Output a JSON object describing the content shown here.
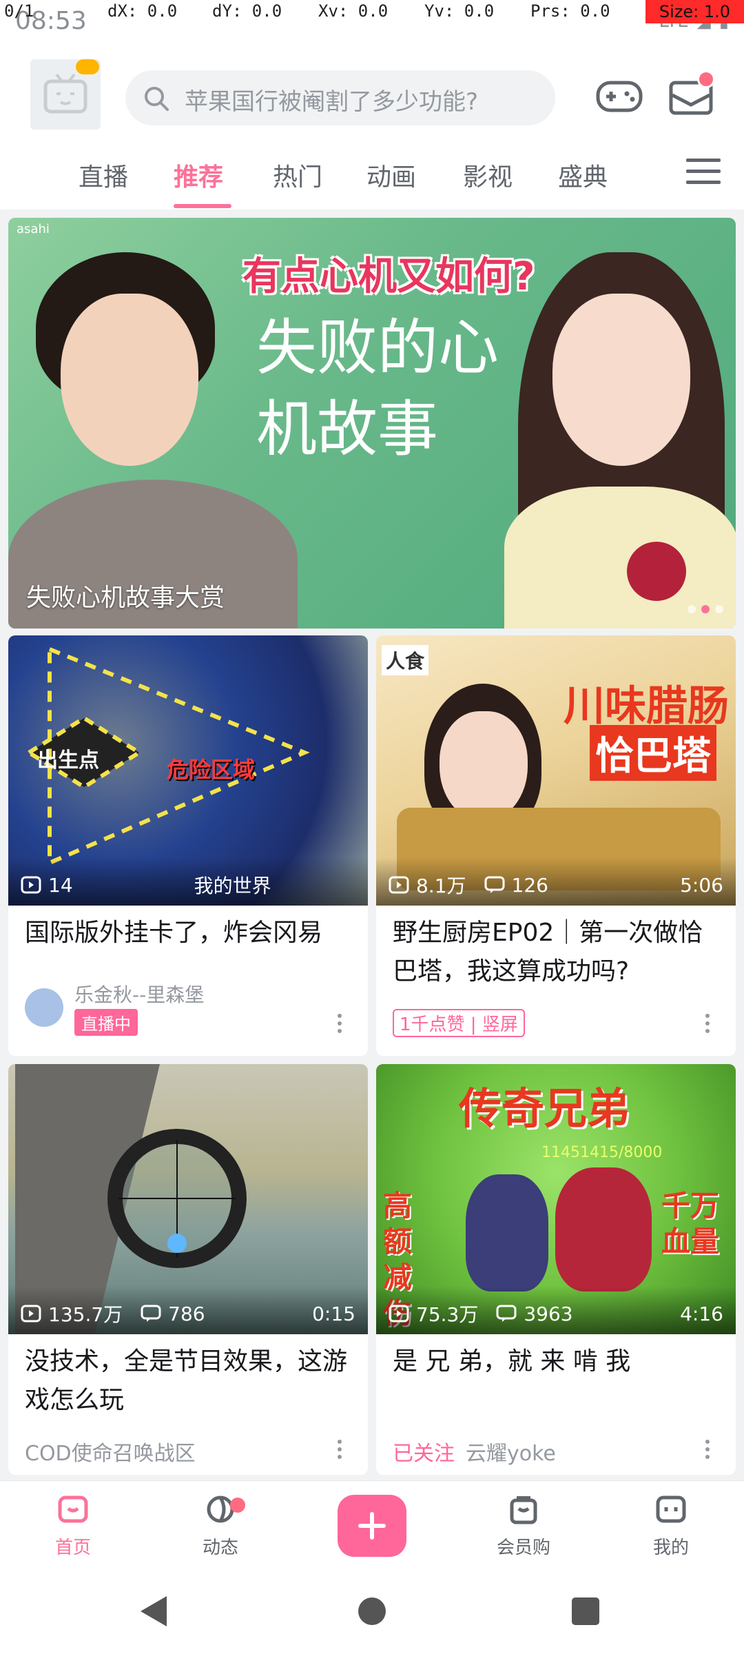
{
  "status_bar": {
    "time": "08:53",
    "network": "LTE",
    "overlay": {
      "pointer": "0/1",
      "dx": "dX: 0.0",
      "dy": "dY: 0.0",
      "xv": "Xv: 0.0",
      "yv": "Yv: 0.0",
      "prs": "Prs: 0.0",
      "size": "Size: 1.0"
    }
  },
  "header": {
    "search_placeholder": "苹果国行被阉割了多少功能?",
    "avatar_icon": "tv-avatar-icon",
    "game_icon": "gamepad-icon",
    "message_icon": "mail-icon"
  },
  "tabs": [
    {
      "label": "直播"
    },
    {
      "label": "推荐"
    },
    {
      "label": "热门"
    },
    {
      "label": "动画"
    },
    {
      "label": "影视"
    },
    {
      "label": "盛典"
    }
  ],
  "banner": {
    "watermark": "asahi",
    "top_text": "有点心机又如何?",
    "big_text": "失败的心机故事",
    "caption": "失败心机故事大赏"
  },
  "cards": [
    {
      "thumb_text_1": "出生点",
      "thumb_text_2": "危险区域",
      "views": "14",
      "comments": "我的世界",
      "title": "国际版外挂卡了，炸会冈易",
      "uploader": "乐金秋--里森堡",
      "live_badge": "直播中"
    },
    {
      "thumb_text_1": "川味腊肠",
      "thumb_text_2": "恰巴塔",
      "thumb_text_3": "人食",
      "views": "8.1万",
      "comments": "126",
      "duration": "5:06",
      "title": "野生厨房EP02｜第一次做恰巴塔，我这算成功吗?",
      "tag": "1千点赞 | 竖屏"
    },
    {
      "views": "135.7万",
      "comments": "786",
      "duration": "0:15",
      "title": "没技术，全是节目效果，这游戏怎么玩",
      "meta": "COD使命召唤战区"
    },
    {
      "thumb_title": "传奇兄弟",
      "thumb_score": "11451415/8000",
      "thumb_left": "高额减伤",
      "thumb_right": "千万血量",
      "views": "75.3万",
      "comments": "3963",
      "duration": "4:16",
      "title": "是 兄 弟，就 来 啃 我",
      "follow": "已关注",
      "uploader": "云耀yoke"
    }
  ],
  "bottom_nav": [
    {
      "label": "首页",
      "icon": "home-icon"
    },
    {
      "label": "动态",
      "icon": "activity-icon"
    },
    {
      "label": "",
      "icon": "plus-icon"
    },
    {
      "label": "会员购",
      "icon": "shop-icon"
    },
    {
      "label": "我的",
      "icon": "profile-icon"
    }
  ],
  "colors": {
    "accent": "#fb7299",
    "pink": "#ff6699",
    "text_secondary": "#9499a0"
  }
}
